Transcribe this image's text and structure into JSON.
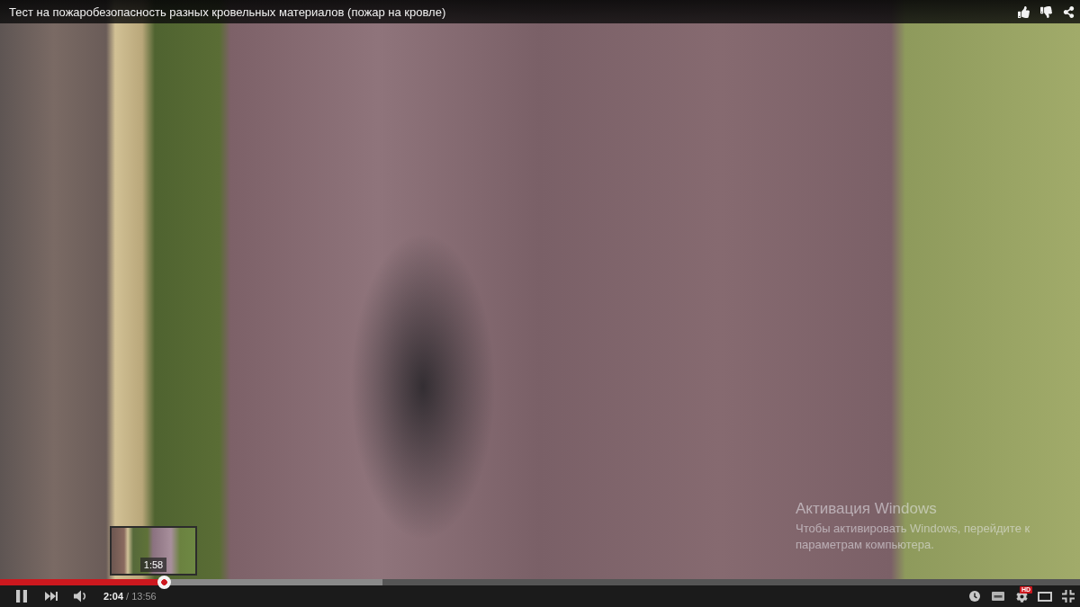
{
  "title_bar": {
    "title": "Тест на пожаробезопасность разных кровельных материалов (пожар на кровле)"
  },
  "watermark": {
    "heading": "Активация Windows",
    "text": "Чтобы активировать Windows, перейдите к параметрам компьютера."
  },
  "scrub_preview": {
    "time": "1:58"
  },
  "progress": {
    "played": {
      "level": 0.152
    },
    "buffered": {
      "level": 0.354
    }
  },
  "controls": {
    "playing": true,
    "time": "**2:04** / 13:56",
    "quality_badge": "HD"
  }
}
